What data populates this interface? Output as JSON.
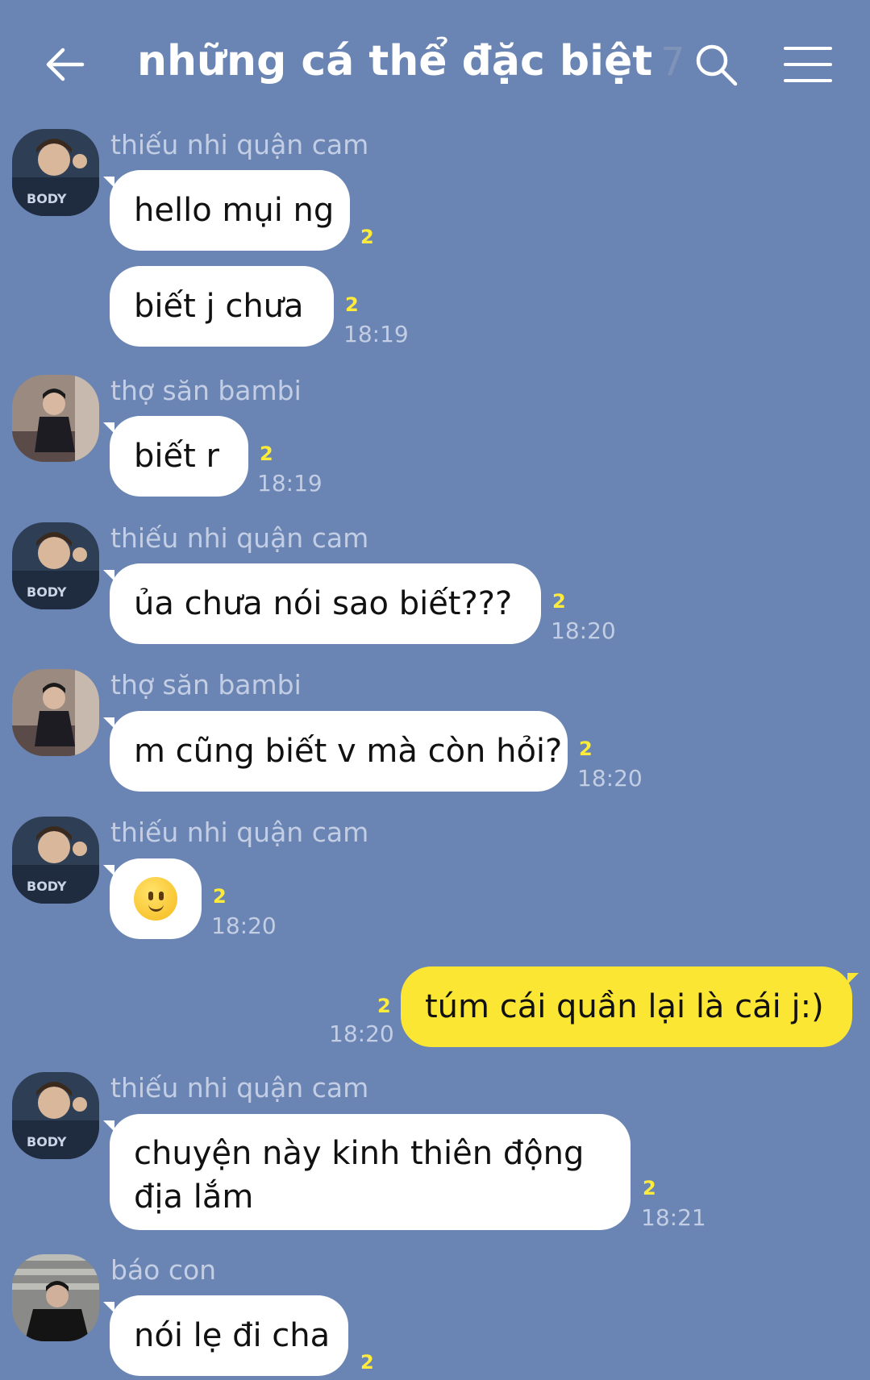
{
  "header": {
    "title": "những cá thể đặc biệt",
    "member_count": "7",
    "back_icon": "arrow-left-icon",
    "search_icon": "search-icon",
    "menu_icon": "hamburger-menu-icon"
  },
  "colors": {
    "background": "#6a85b3",
    "bubble_other": "#ffffff",
    "bubble_mine": "#fce634",
    "read_count": "#ffec3a"
  },
  "messages": [
    {
      "sender": "thiếu nhi quận cam",
      "text": "hello mụi ng",
      "read": "2",
      "time": ""
    },
    {
      "sender": "",
      "text": "biết j chưa",
      "read": "2",
      "time": "18:19"
    },
    {
      "sender": "thợ săn bambi",
      "text": "biết r",
      "read": "2",
      "time": "18:19"
    },
    {
      "sender": "thiếu nhi quận cam",
      "text": "ủa chưa nói sao biết???",
      "read": "2",
      "time": "18:20"
    },
    {
      "sender": "thợ săn bambi",
      "text": "m cũng biết v mà còn hỏi?",
      "read": "2",
      "time": "18:20"
    },
    {
      "sender": "thiếu nhi quận cam",
      "text": "",
      "emoji": "slightly-smiling-face-emoji",
      "read": "2",
      "time": "18:20"
    },
    {
      "sender": "me",
      "text": "túm cái quần lại là cái j:)",
      "read": "2",
      "time": "18:20"
    },
    {
      "sender": "thiếu nhi quận cam",
      "text_line1": "chuyện này kinh thiên động",
      "text_line2": "địa lắm",
      "read": "2",
      "time": "18:21"
    },
    {
      "sender": "báo con",
      "text": "nói lẹ đi cha",
      "read": "2",
      "time": ""
    }
  ]
}
